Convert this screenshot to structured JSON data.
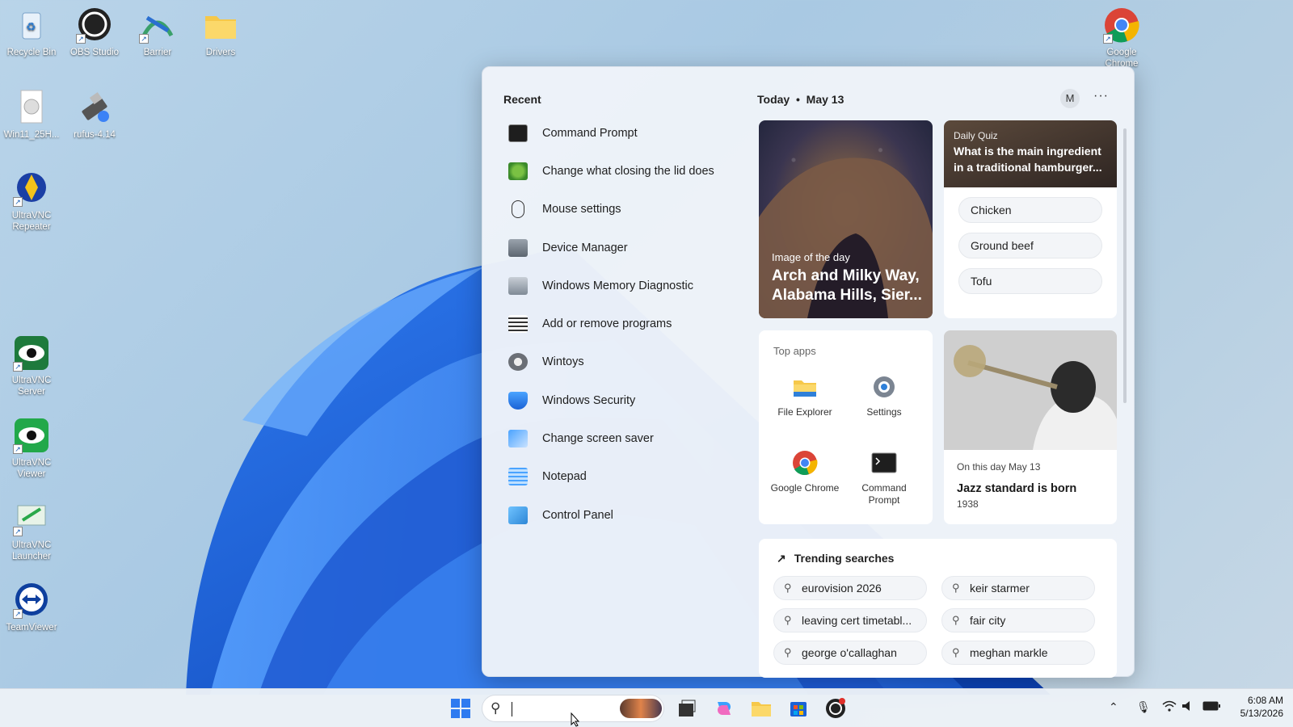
{
  "desktop": {
    "icons": [
      {
        "label": "Recycle Bin",
        "icon": "recycle-bin-icon"
      },
      {
        "label": "OBS Studio",
        "icon": "obs-icon"
      },
      {
        "label": "Barrier",
        "icon": "barrier-icon"
      },
      {
        "label": "Drivers",
        "icon": "folder-icon"
      },
      {
        "label": "Win11_25H...",
        "icon": "disc-image-icon"
      },
      {
        "label": "rufus-4.14",
        "icon": "usb-icon"
      },
      {
        "label": "UltraVNC Repeater",
        "icon": "ultravnc-repeater-icon"
      },
      {
        "label": "UltraVNC Server",
        "icon": "eye-icon"
      },
      {
        "label": "UltraVNC Viewer",
        "icon": "eye-icon"
      },
      {
        "label": "UltraVNC Launcher",
        "icon": "launcher-icon"
      },
      {
        "label": "TeamViewer",
        "icon": "teamviewer-icon"
      },
      {
        "label": "Google Chrome",
        "icon": "chrome-icon"
      }
    ]
  },
  "panel": {
    "recent_title": "Recent",
    "recent": [
      {
        "label": "Command Prompt",
        "icon": "cmd-icon"
      },
      {
        "label": "Change what closing the lid does",
        "icon": "power-icon"
      },
      {
        "label": "Mouse settings",
        "icon": "mouse-icon"
      },
      {
        "label": "Device Manager",
        "icon": "device-manager-icon"
      },
      {
        "label": "Windows Memory Diagnostic",
        "icon": "memory-icon"
      },
      {
        "label": "Add or remove programs",
        "icon": "list-icon"
      },
      {
        "label": "Wintoys",
        "icon": "gear-icon"
      },
      {
        "label": "Windows Security",
        "icon": "shield-icon"
      },
      {
        "label": "Change screen saver",
        "icon": "monitor-icon"
      },
      {
        "label": "Notepad",
        "icon": "notepad-icon"
      },
      {
        "label": "Control Panel",
        "icon": "control-panel-icon"
      }
    ],
    "today_label": "Today",
    "date": "May 13",
    "avatar": "M",
    "more": "···",
    "image_of_day": {
      "kicker": "Image of the day",
      "title": "Arch and Milky Way, Alabama Hills, Sier..."
    },
    "quiz": {
      "kicker": "Daily Quiz",
      "question": "What is the main ingredient in a traditional hamburger...",
      "options": [
        "Chicken",
        "Ground beef",
        "Tofu"
      ]
    },
    "top_apps": {
      "title": "Top apps",
      "apps": [
        {
          "label": "File Explorer",
          "icon": "folder-icon"
        },
        {
          "label": "Settings",
          "icon": "gear-icon"
        },
        {
          "label": "Google Chrome",
          "icon": "chrome-icon"
        },
        {
          "label": "Command Prompt",
          "icon": "cmd-icon"
        }
      ]
    },
    "on_this_day": {
      "kicker": "On this day May 13",
      "title": "Jazz standard is born",
      "year": "1938"
    },
    "trending": {
      "title": "Trending searches",
      "items": [
        "eurovision 2026",
        "keir starmer",
        "leaving cert timetabl...",
        "fair city",
        "george o'callaghan",
        "meghan markle"
      ]
    }
  },
  "taskbar": {
    "time": "6:08 AM",
    "date": "5/13/2026"
  }
}
